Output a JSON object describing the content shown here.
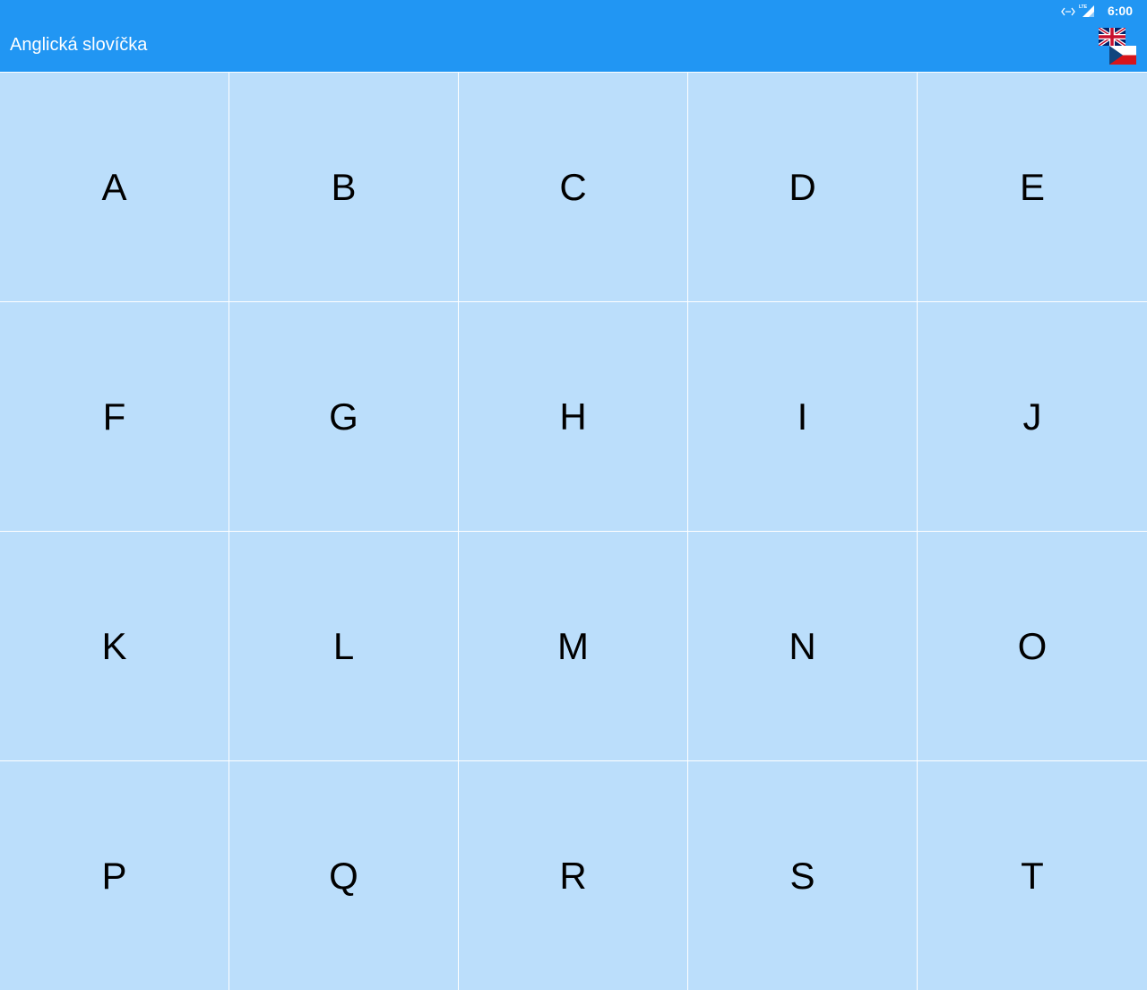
{
  "status_bar": {
    "time": "6:00",
    "icons": [
      "data-sync-icon",
      "lte-signal-icon"
    ]
  },
  "app_bar": {
    "title": "Anglická slovíčka",
    "language_toggle_icons": [
      "uk-flag-icon",
      "czech-flag-icon"
    ]
  },
  "letters": [
    "A",
    "B",
    "C",
    "D",
    "E",
    "F",
    "G",
    "H",
    "I",
    "J",
    "K",
    "L",
    "M",
    "N",
    "O",
    "P",
    "Q",
    "R",
    "S",
    "T"
  ],
  "colors": {
    "app_bar": "#2196f3",
    "tile": "#bbdefb",
    "divider": "#ffffff",
    "tile_text": "#000000"
  }
}
